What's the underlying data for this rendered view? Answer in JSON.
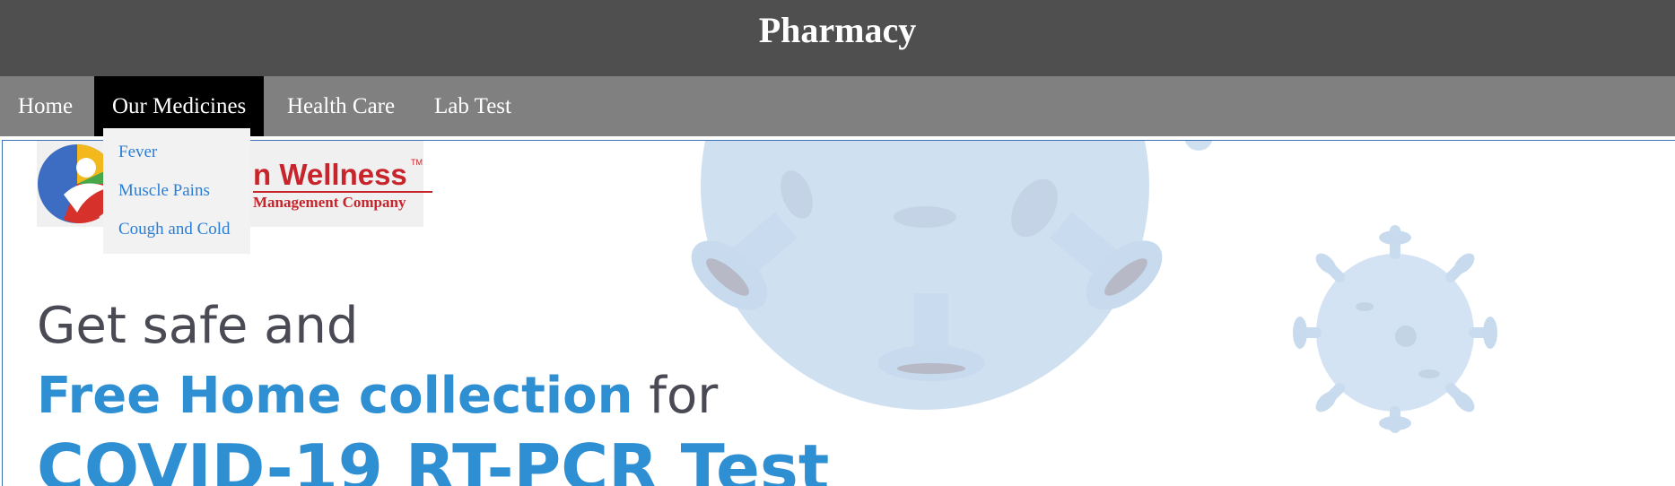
{
  "header": {
    "title": "Pharmacy"
  },
  "nav": {
    "items": [
      {
        "label": "Home"
      },
      {
        "label": "Our Medicines"
      },
      {
        "label": "Health Care"
      },
      {
        "label": "Lab Test"
      }
    ],
    "active_index": 1
  },
  "dropdown": {
    "items": [
      {
        "label": "Fever"
      },
      {
        "label": "Muscle Pains"
      },
      {
        "label": "Cough and Cold"
      }
    ]
  },
  "banner": {
    "logo": {
      "brand_partial": "n Wellness",
      "tagline_partial": "Management Company",
      "tm": "TM"
    },
    "line1": "Get safe and",
    "line2_highlight": "Free Home collection",
    "line2_rest": " for",
    "line3": "COVID-19 RT-PCR Test"
  },
  "colors": {
    "header_bg": "#4f4f4f",
    "nav_bg": "#808080",
    "nav_active_bg": "#000000",
    "dropdown_link": "#2b7ed6",
    "accent_blue": "#2e8fd3",
    "brand_red": "#c8242b"
  }
}
